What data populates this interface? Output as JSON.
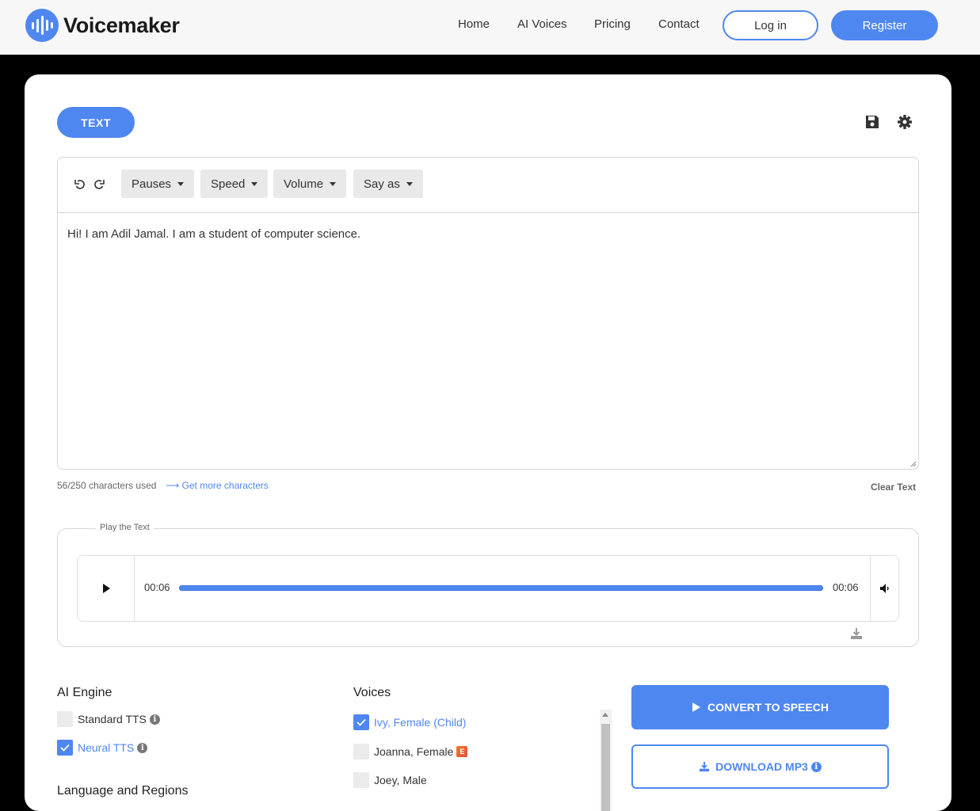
{
  "header": {
    "brand": "Voicemaker",
    "nav": [
      "Home",
      "AI Voices",
      "Pricing",
      "Contact"
    ],
    "login_label": "Log in",
    "register_label": "Register"
  },
  "mode_tab": "TEXT",
  "toolbar": {
    "dropdowns": [
      "Pauses",
      "Speed",
      "Volume",
      "Say as"
    ]
  },
  "editor": {
    "text": "Hi! I am Adil Jamal. I am a student of computer science."
  },
  "counter": {
    "used": "56/250 characters used",
    "more_link": "Get more characters",
    "clear_label": "Clear Text"
  },
  "player": {
    "legend": "Play the Text",
    "current_time": "00:06",
    "total_time": "00:06",
    "progress": 1.0
  },
  "engine": {
    "title": "AI Engine",
    "options": [
      {
        "label": "Standard TTS",
        "checked": false
      },
      {
        "label": "Neural TTS",
        "checked": true
      }
    ]
  },
  "voices": {
    "title": "Voices",
    "items": [
      {
        "label": "Ivy, Female (Child)",
        "checked": true
      },
      {
        "label": "Joanna, Female",
        "checked": false,
        "badge": "E"
      },
      {
        "label": "Joey, Male",
        "checked": false
      }
    ]
  },
  "languages": {
    "title": "Language and Regions"
  },
  "actions": {
    "convert_label": "CONVERT TO SPEECH",
    "download_label": "DOWNLOAD MP3"
  },
  "colors": {
    "accent": "#4f87f0"
  }
}
